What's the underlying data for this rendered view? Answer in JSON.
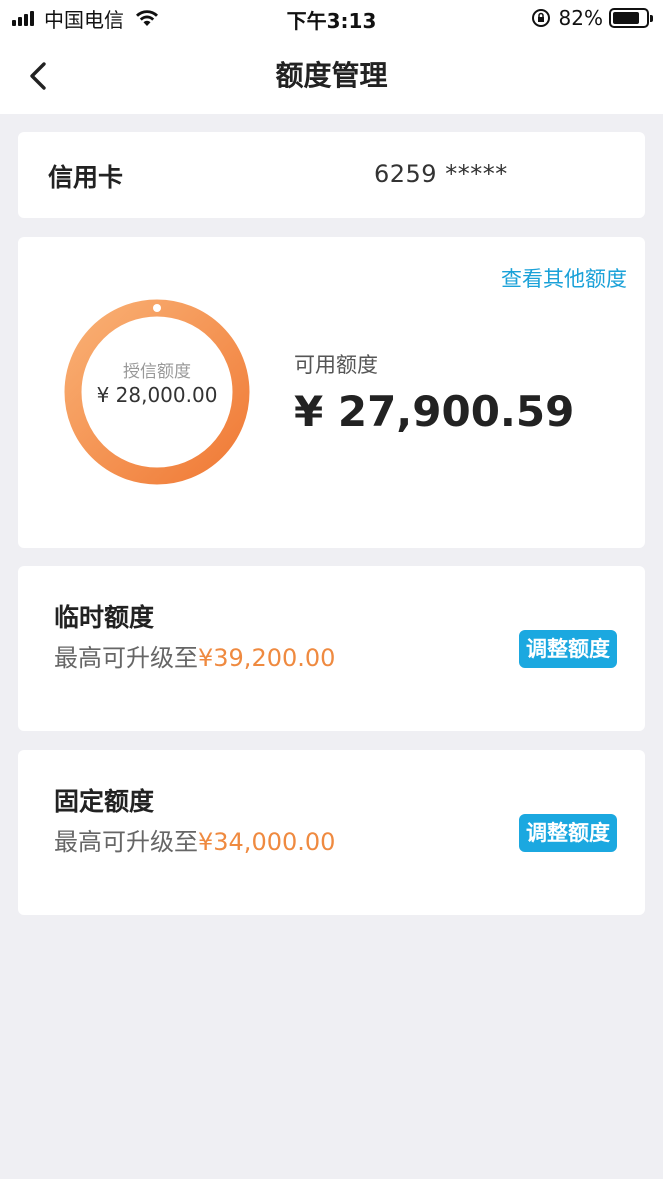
{
  "status_bar": {
    "carrier": "中国电信",
    "time": "下午3:13",
    "battery_percent": "82%",
    "battery_level": 0.82,
    "icons": [
      "signal-icon",
      "wifi-icon",
      "orientation-lock-icon",
      "battery-icon"
    ]
  },
  "nav": {
    "title": "额度管理",
    "back_icon": "chevron-left-icon"
  },
  "card_info": {
    "label": "信用卡",
    "number": "6259 *****"
  },
  "limit_overview": {
    "view_other": "查看其他额度",
    "ring_label": "授信额度",
    "ring_value": "¥ 28,000.00",
    "available_label": "可用额度",
    "available_value": "¥ 27,900.59",
    "available_fraction": 0.9964,
    "colors": {
      "ring_start": "#f7a35f",
      "ring_end": "#f07a36"
    }
  },
  "temporary_limit": {
    "title": "临时额度",
    "desc_prefix": "最高可升级至",
    "amount": "¥39,200.00",
    "button": "调整额度"
  },
  "fixed_limit": {
    "title": "固定额度",
    "desc_prefix": "最高可升级至",
    "amount": "¥34,000.00",
    "button": "调整额度"
  },
  "colors": {
    "accent": "#1ba8e0",
    "link": "#1aa1d8",
    "amount": "#ef8a40",
    "background": "#efeff3"
  }
}
